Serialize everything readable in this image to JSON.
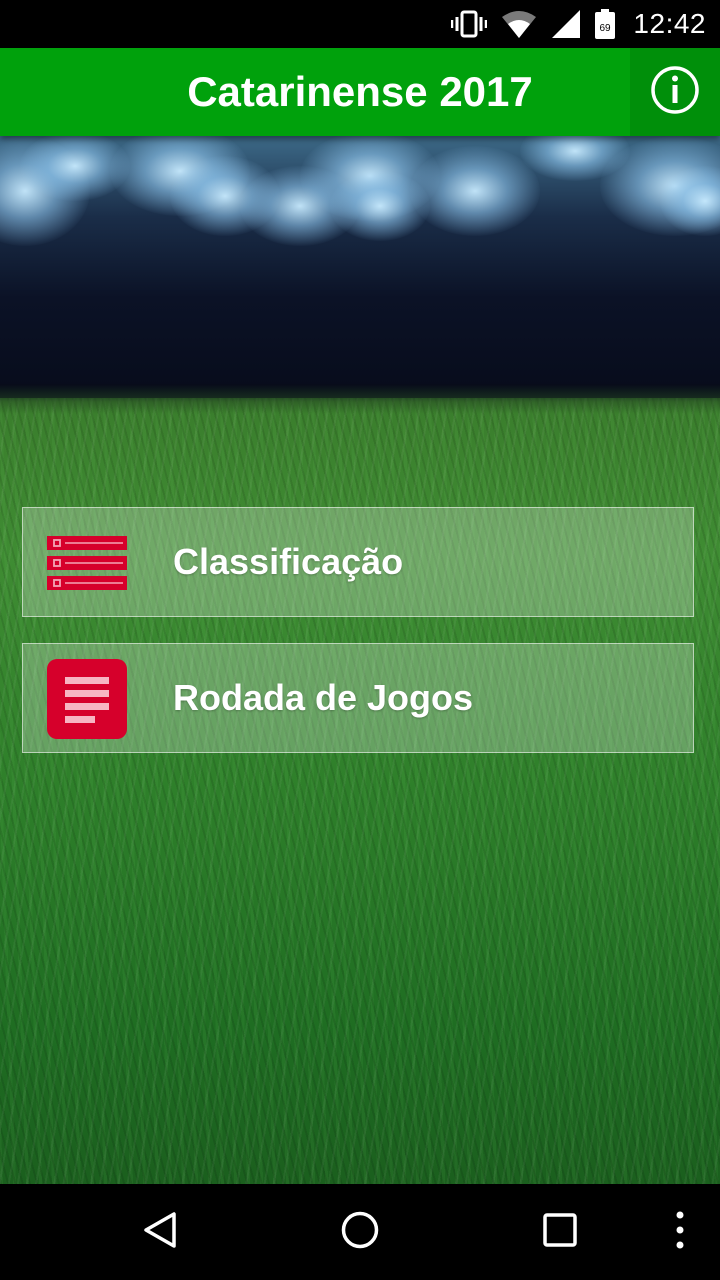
{
  "status_bar": {
    "time": "12:42",
    "icons": [
      "vibrate-icon",
      "wifi-icon",
      "signal-icon",
      "battery-icon"
    ],
    "battery_level": "69"
  },
  "app_bar": {
    "title": "Catarinense 2017",
    "info_icon": "info-icon"
  },
  "menu": {
    "items": [
      {
        "label": "Classificação",
        "icon": "standings-list-icon"
      },
      {
        "label": "Rodada de Jogos",
        "icon": "document-icon"
      }
    ]
  },
  "nav_bar": {
    "icons": [
      "back-icon",
      "home-icon",
      "recents-icon",
      "overflow-menu-icon"
    ]
  },
  "colors": {
    "app_bar": "#00a10c",
    "icon_red": "#d6002b"
  }
}
